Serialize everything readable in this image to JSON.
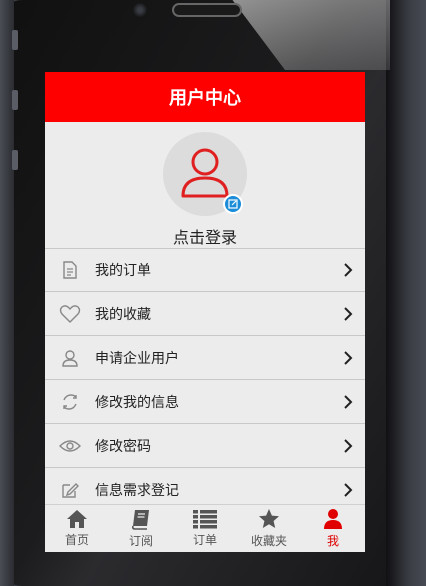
{
  "header": {
    "title": "用户中心"
  },
  "profile": {
    "login_label": "点击登录"
  },
  "menu": [
    {
      "label": "我的订单",
      "icon": "document-icon"
    },
    {
      "label": "我的收藏",
      "icon": "heart-icon"
    },
    {
      "label": "申请企业用户",
      "icon": "user-icon"
    },
    {
      "label": "修改我的信息",
      "icon": "refresh-icon"
    },
    {
      "label": "修改密码",
      "icon": "eye-icon"
    },
    {
      "label": "信息需求登记",
      "icon": "edit-icon"
    }
  ],
  "tabs": [
    {
      "label": "首页",
      "icon": "home-icon"
    },
    {
      "label": "订阅",
      "icon": "book-icon"
    },
    {
      "label": "订单",
      "icon": "list-icon"
    },
    {
      "label": "收藏夹",
      "icon": "star-icon"
    },
    {
      "label": "我",
      "icon": "person-icon"
    }
  ],
  "colors": {
    "accent": "#ff0000",
    "badge": "#1a8cd8",
    "active_tab": "#e00000"
  }
}
